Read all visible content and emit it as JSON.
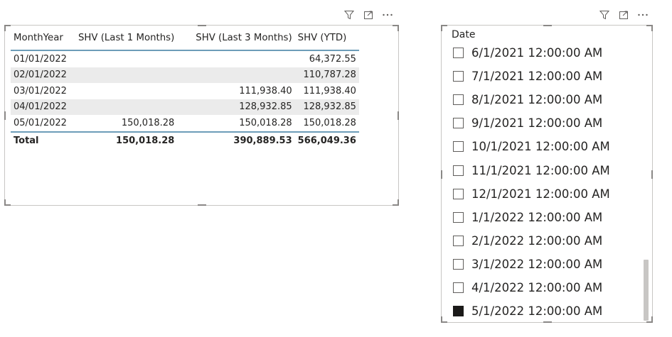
{
  "table_visual": {
    "columns": [
      "MonthYear",
      "SHV (Last 1 Months)",
      "SHV (Last 3 Months)",
      "SHV (YTD)"
    ],
    "rows": [
      [
        "01/01/2022",
        "",
        "",
        "64,372.55"
      ],
      [
        "02/01/2022",
        "",
        "",
        "110,787.28"
      ],
      [
        "03/01/2022",
        "",
        "111,938.40",
        "111,938.40"
      ],
      [
        "04/01/2022",
        "",
        "128,932.85",
        "128,932.85"
      ],
      [
        "05/01/2022",
        "150,018.28",
        "150,018.28",
        "150,018.28"
      ]
    ],
    "total": [
      "Total",
      "150,018.28",
      "390,889.53",
      "566,049.36"
    ],
    "header_icons": [
      "filter-icon",
      "focus-mode-icon",
      "more-options-icon"
    ]
  },
  "slicer_visual": {
    "title": "Date",
    "items": [
      {
        "label": "6/1/2021 12:00:00 AM",
        "checked": false
      },
      {
        "label": "7/1/2021 12:00:00 AM",
        "checked": false
      },
      {
        "label": "8/1/2021 12:00:00 AM",
        "checked": false
      },
      {
        "label": "9/1/2021 12:00:00 AM",
        "checked": false
      },
      {
        "label": "10/1/2021 12:00:00 AM",
        "checked": false
      },
      {
        "label": "11/1/2021 12:00:00 AM",
        "checked": false
      },
      {
        "label": "12/1/2021 12:00:00 AM",
        "checked": false
      },
      {
        "label": "1/1/2022 12:00:00 AM",
        "checked": false
      },
      {
        "label": "2/1/2022 12:00:00 AM",
        "checked": false
      },
      {
        "label": "3/1/2022 12:00:00 AM",
        "checked": false
      },
      {
        "label": "4/1/2022 12:00:00 AM",
        "checked": false
      },
      {
        "label": "5/1/2022 12:00:00 AM",
        "checked": true
      }
    ],
    "header_icons": [
      "filter-icon",
      "focus-mode-icon",
      "more-options-icon"
    ]
  },
  "colors": {
    "table_rule": "#6d9db8",
    "alt_row": "#ebebeb",
    "checked_fill": "#1b1a19"
  }
}
